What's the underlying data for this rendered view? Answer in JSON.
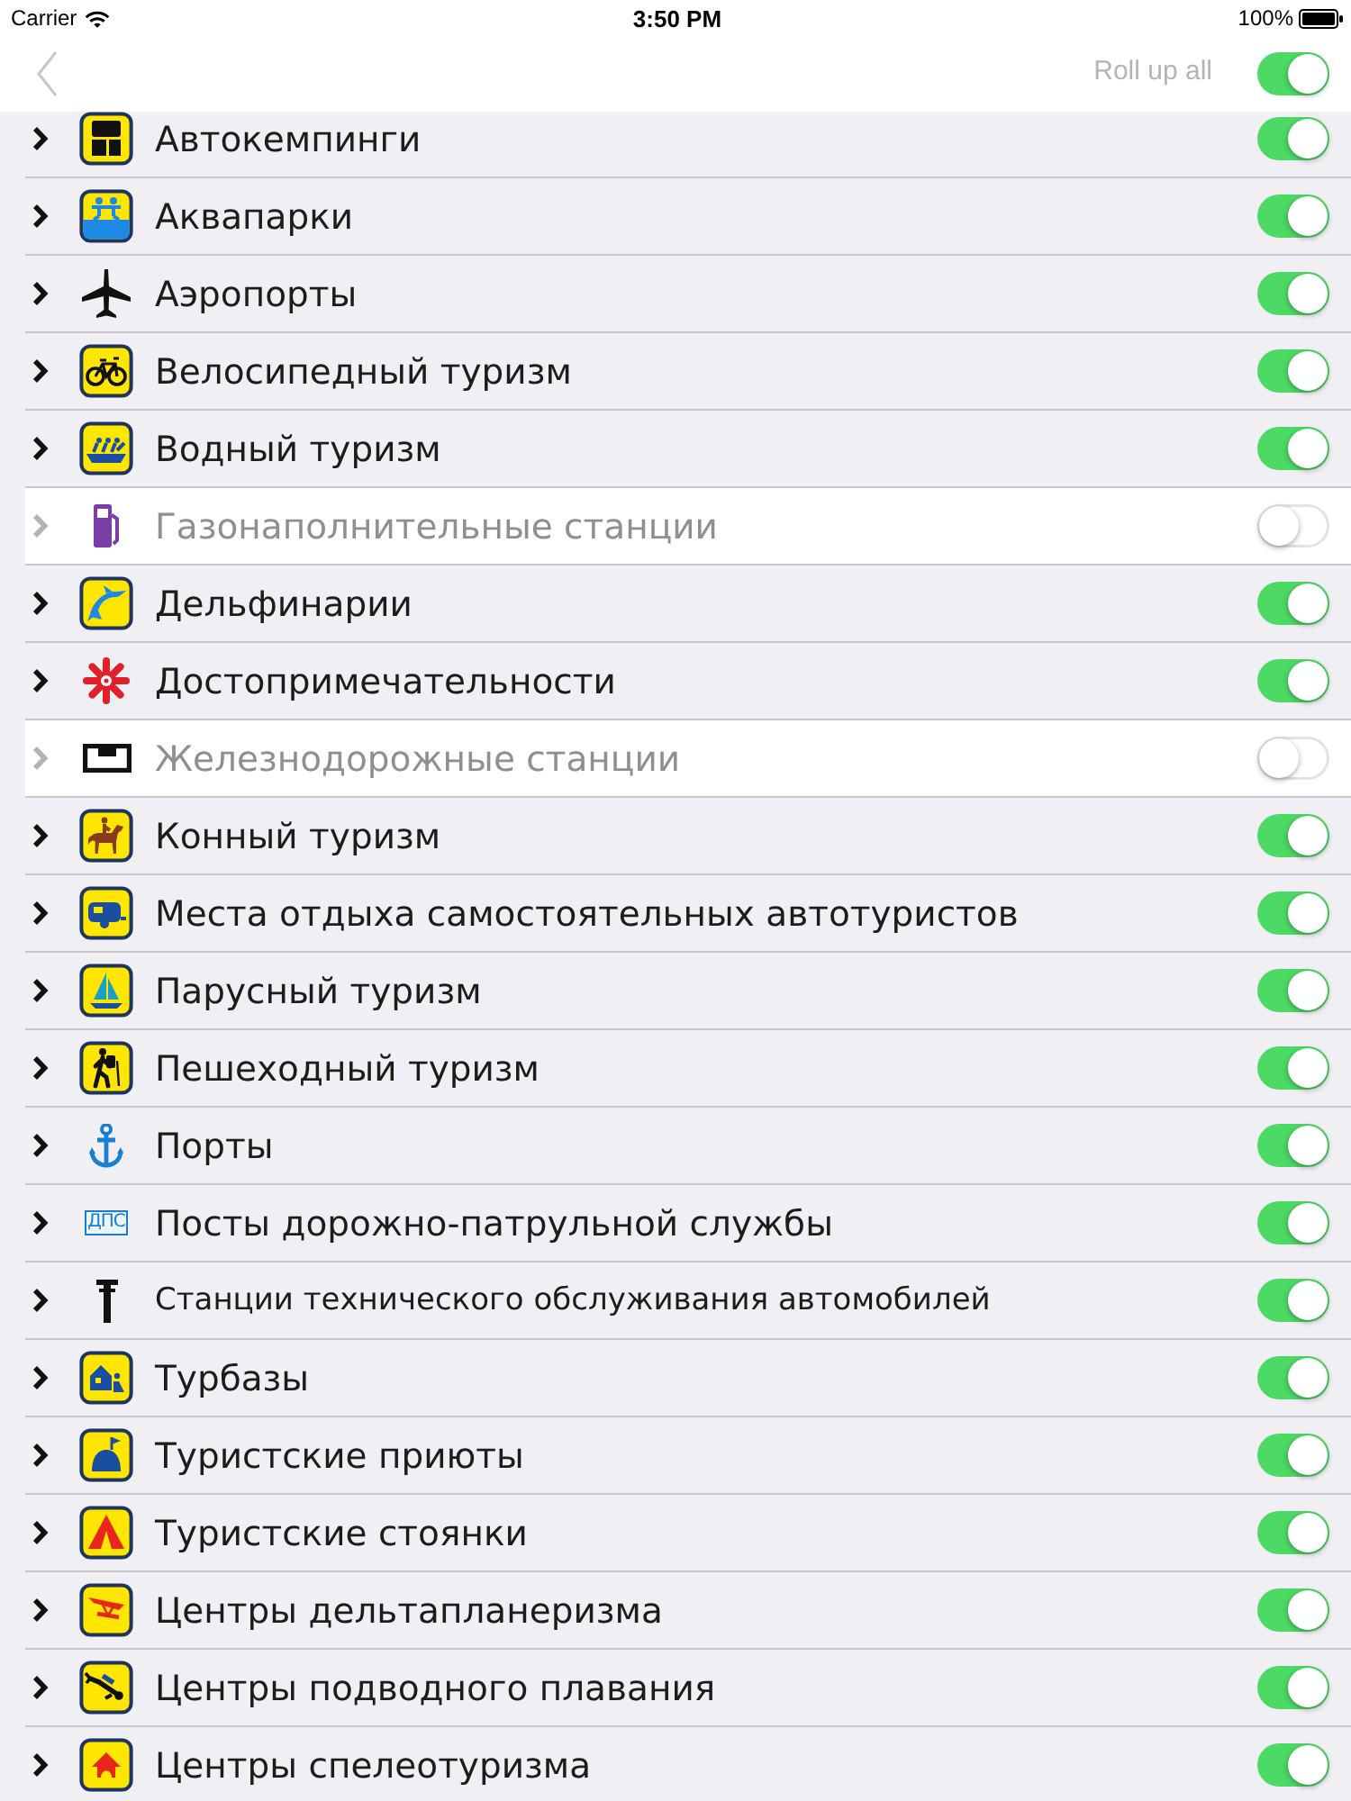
{
  "status_bar": {
    "carrier": "Carrier",
    "time": "3:50 PM",
    "battery": "100%"
  },
  "nav_bar": {
    "roll_up_label": "Roll up all",
    "roll_up_on": true
  },
  "categories": [
    {
      "name": "Автокемпинги",
      "on": true
    },
    {
      "name": "Аквапарки",
      "on": true
    },
    {
      "name": "Аэропорты",
      "on": true
    },
    {
      "name": "Велосипедный туризм",
      "on": true
    },
    {
      "name": "Водный туризм",
      "on": true
    },
    {
      "name": "Газонаполнительные станции",
      "on": false
    },
    {
      "name": "Дельфинарии",
      "on": true
    },
    {
      "name": "Достопримечательности",
      "on": true
    },
    {
      "name": "Железнодорожные станции",
      "on": false
    },
    {
      "name": "Конный туризм",
      "on": true
    },
    {
      "name": "Места отдыха самостоятельных автотуристов",
      "on": true
    },
    {
      "name": "Парусный туризм",
      "on": true
    },
    {
      "name": "Пешеходный туризм",
      "on": true
    },
    {
      "name": "Порты",
      "on": true
    },
    {
      "name": "Посты дорожно-патрульной службы",
      "on": true,
      "icon_text": "ДПС"
    },
    {
      "name": "Станции технического обслуживания автомобилей",
      "on": true
    },
    {
      "name": "Турбазы",
      "on": true
    },
    {
      "name": "Туристские приюты",
      "on": true
    },
    {
      "name": "Туристские стоянки",
      "on": true
    },
    {
      "name": "Центры дельтапланеризма",
      "on": true
    },
    {
      "name": "Центры подводного плавания",
      "on": true
    },
    {
      "name": "Центры спелеотуризма",
      "on": true
    }
  ]
}
